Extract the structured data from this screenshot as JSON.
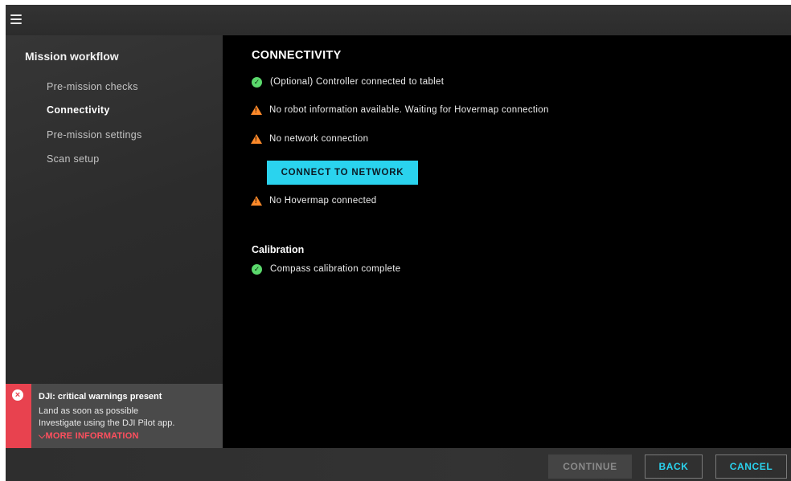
{
  "sidebar": {
    "title": "Mission workflow",
    "items": [
      {
        "label": "Pre-mission checks"
      },
      {
        "label": "Connectivity"
      },
      {
        "label": "Pre-mission settings"
      },
      {
        "label": "Scan setup"
      }
    ],
    "active_index": 1
  },
  "alert": {
    "icon": "error-x-icon",
    "title": "DJI: critical warnings present",
    "line1": "Land as soon as possible",
    "line2": "Investigate using the DJI Pilot app.",
    "more_label": "MORE INFORMATION",
    "color": "#e8424f"
  },
  "main": {
    "title": "CONNECTIVITY",
    "checks": [
      {
        "status": "ok",
        "icon": "check-circle-icon",
        "text": "(Optional) Controller connected to tablet"
      },
      {
        "status": "warning",
        "icon": "warning-triangle-icon",
        "text": "No robot information available. Waiting for Hovermap connection"
      },
      {
        "status": "warning",
        "icon": "warning-triangle-icon",
        "text": "No network connection"
      },
      {
        "status": "warning",
        "icon": "warning-triangle-icon",
        "text": "No Hovermap connected"
      }
    ],
    "connect_button": "CONNECT TO NETWORK",
    "calibration_title": "Calibration",
    "calibration": [
      {
        "status": "ok",
        "icon": "check-circle-icon",
        "text": "Compass calibration complete"
      }
    ]
  },
  "footer": {
    "continue_label": "CONTINUE",
    "back_label": "BACK",
    "cancel_label": "CANCEL"
  },
  "colors": {
    "accent": "#2ad3ee",
    "ok": "#5bd96c",
    "warning": "#ff8a2a",
    "error": "#e8424f"
  }
}
